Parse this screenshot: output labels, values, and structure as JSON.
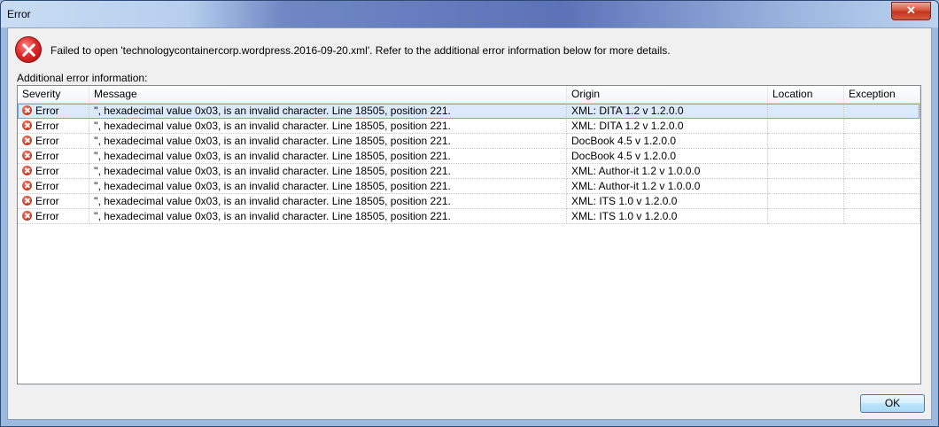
{
  "window": {
    "title": "Error",
    "close_label": "✕"
  },
  "message": {
    "text": "Failed to open 'technologycontainercorp.wordpress.2016-09-20.xml'. Refer to the additional error information below for more details.",
    "additional_label": "Additional error information:"
  },
  "table": {
    "columns": [
      "Severity",
      "Message",
      "Origin",
      "Location",
      "Exception"
    ],
    "rows": [
      {
        "severity": "Error",
        "message": "'', hexadecimal value 0x03, is an invalid character. Line 18505, position 221.",
        "origin": "XML: DITA 1.2 v 1.2.0.0",
        "location": "",
        "exception": ""
      },
      {
        "severity": "Error",
        "message": "'', hexadecimal value 0x03, is an invalid character. Line 18505, position 221.",
        "origin": "XML: DITA 1.2 v 1.2.0.0",
        "location": "",
        "exception": ""
      },
      {
        "severity": "Error",
        "message": "'', hexadecimal value 0x03, is an invalid character. Line 18505, position 221.",
        "origin": "DocBook 4.5 v 1.2.0.0",
        "location": "",
        "exception": ""
      },
      {
        "severity": "Error",
        "message": "'', hexadecimal value 0x03, is an invalid character. Line 18505, position 221.",
        "origin": "DocBook 4.5 v 1.2.0.0",
        "location": "",
        "exception": ""
      },
      {
        "severity": "Error",
        "message": "'', hexadecimal value 0x03, is an invalid character. Line 18505, position 221.",
        "origin": "XML: Author-it 1.2 v 1.0.0.0",
        "location": "",
        "exception": ""
      },
      {
        "severity": "Error",
        "message": "'', hexadecimal value 0x03, is an invalid character. Line 18505, position 221.",
        "origin": "XML: Author-it 1.2 v 1.0.0.0",
        "location": "",
        "exception": ""
      },
      {
        "severity": "Error",
        "message": "'', hexadecimal value 0x03, is an invalid character. Line 18505, position 221.",
        "origin": "XML: ITS 1.0 v 1.2.0.0",
        "location": "",
        "exception": ""
      },
      {
        "severity": "Error",
        "message": "'', hexadecimal value 0x03, is an invalid character. Line 18505, position 221.",
        "origin": "XML: ITS 1.0 v 1.2.0.0",
        "location": "",
        "exception": ""
      }
    ],
    "selected_row": 0
  },
  "buttons": {
    "ok_label": "OK"
  },
  "icons": {
    "dialog_icon": "error-icon",
    "severity_icon": "error-icon",
    "close_icon": "close-icon"
  },
  "colors": {
    "error_red": "#d23a22",
    "selection": "#dbe9f9",
    "accent": "#3c7fb1"
  }
}
